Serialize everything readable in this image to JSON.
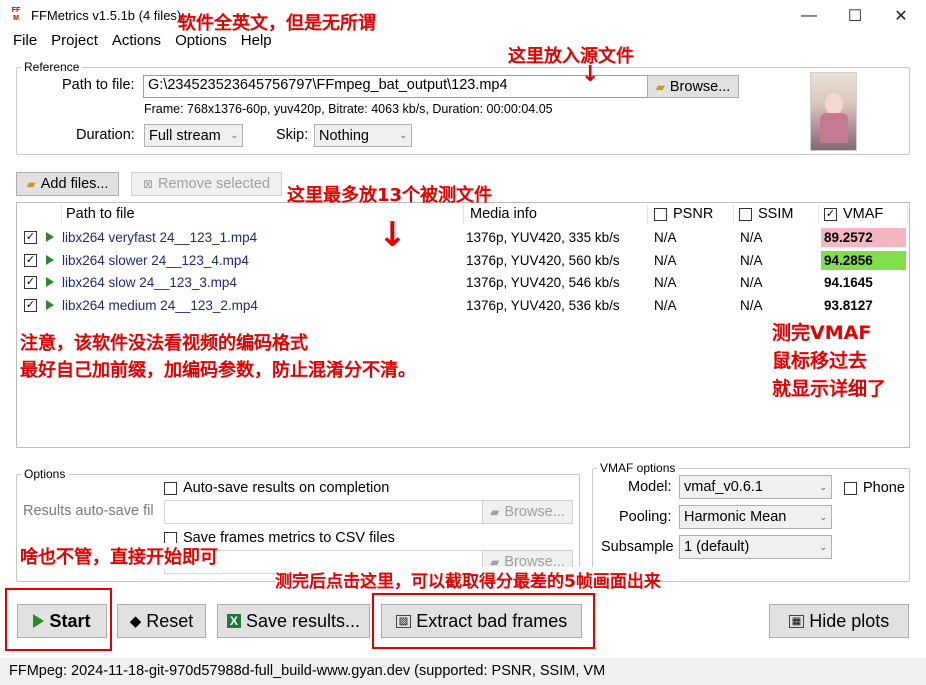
{
  "window": {
    "title": "FFMetrics v1.5.1b (4 files)",
    "icon_text": "FF M",
    "controls": {
      "minimize": "—",
      "maximize": "☐",
      "close": "✕"
    }
  },
  "menu": [
    "File",
    "Project",
    "Actions",
    "Options",
    "Help"
  ],
  "reference": {
    "group_label": "Reference",
    "path_label": "Path to file:",
    "path_value": "G:\\234523523645756797\\FFmpeg_bat_output\\123.mp4",
    "browse_label": "Browse...",
    "frame_info": "Frame: 768x1376-60p, yuv420p, Bitrate: 4063 kb/s, Duration: 00:00:04.05",
    "duration_label": "Duration:",
    "duration_value": "Full stream",
    "skip_label": "Skip:",
    "skip_value": "Nothing"
  },
  "file_buttons": {
    "add": "Add files...",
    "remove": "Remove selected"
  },
  "file_list": {
    "columns": {
      "path": "Path to file",
      "media": "Media info",
      "psnr": "PSNR",
      "ssim": "SSIM",
      "vmaf": "VMAF"
    },
    "rows": [
      {
        "file": "libx264 veryfast 24__123_1.mp4",
        "media": "1376p, YUV420, 335 kb/s",
        "psnr": "N/A",
        "ssim": "N/A",
        "vmaf": "89.2572",
        "vmaf_bg": "#f4b6c0"
      },
      {
        "file": "libx264 slower 24__123_4.mp4",
        "media": "1376p, YUV420, 560 kb/s",
        "psnr": "N/A",
        "ssim": "N/A",
        "vmaf": "94.2856",
        "vmaf_bg": "#7fe04a"
      },
      {
        "file": "libx264 slow 24__123_3.mp4",
        "media": "1376p, YUV420, 546 kb/s",
        "psnr": "N/A",
        "ssim": "N/A",
        "vmaf": "94.1645",
        "vmaf_bg": "#ffffff"
      },
      {
        "file": "libx264 medium 24__123_2.mp4",
        "media": "1376p, YUV420, 536 kb/s",
        "psnr": "N/A",
        "ssim": "N/A",
        "vmaf": "93.8127",
        "vmaf_bg": "#ffffff"
      }
    ]
  },
  "options": {
    "group_label": "Options",
    "autosave_label": "Auto-save results on completion",
    "results_label": "Results auto-save fil",
    "browse1": "Browse...",
    "csv_label": "Save frames metrics to CSV files",
    "metrics_label": "ics",
    "browse2": "Browse..."
  },
  "vmaf_options": {
    "group_label": "VMAF options",
    "model_label": "Model:",
    "model_value": "vmaf_v0.6.1",
    "phone_label": "Phone",
    "pooling_label": "Pooling:",
    "pooling_value": "Harmonic Mean",
    "subsample_label": "Subsample",
    "subsample_value": "1 (default)"
  },
  "actions": {
    "start": "Start",
    "reset": "Reset",
    "save": "Save results...",
    "extract": "Extract bad frames",
    "hide_plots": "Hide plots"
  },
  "status_bar": "FFMpeg: 2024-11-18-git-970d57988d-full_build-www.gyan.dev (supported: PSNR, SSIM, VM",
  "annotations": {
    "title_note": "软件全英文，但是无所谓",
    "source_note": "这里放入源文件",
    "tested_note": "这里最多放13个被测文件",
    "codec_note_1": "注意，该软件没法看视频的编码格式",
    "codec_note_2": "最好自己加前缀，加编码参数，防止混淆分不清。",
    "vmaf_note_1": "测完VMAF",
    "vmaf_note_2": "鼠标移过去",
    "vmaf_note_3": "就显示详细了",
    "start_note": "啥也不管，直接开始即可",
    "extract_note": "测完后点击这里，可以截取得分最差的5帧画面出来",
    "arrow": "↓"
  }
}
